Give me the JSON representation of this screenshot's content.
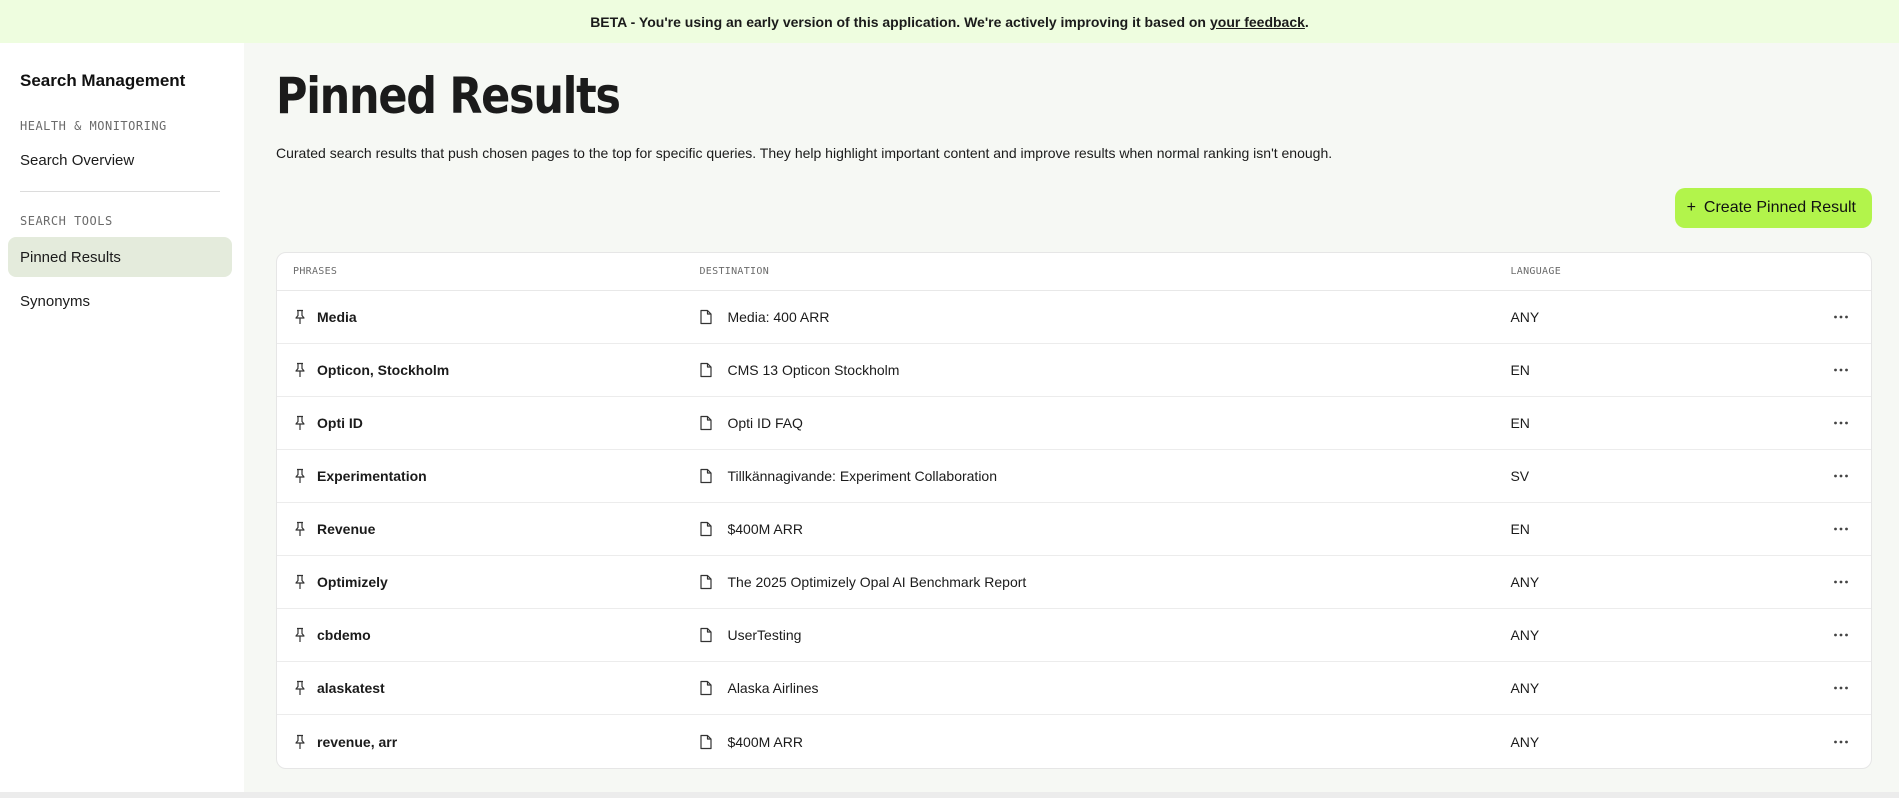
{
  "banner": {
    "text": "BETA - You're using an early version of this application. We're actively improving it based on",
    "link": "your feedback",
    "suffix": "."
  },
  "sidebar": {
    "title": "Search Management",
    "section_health": "HEALTH & MONITORING",
    "item_overview": "Search Overview",
    "section_tools": "SEARCH TOOLS",
    "item_pinned": "Pinned Results",
    "item_synonyms": "Synonyms"
  },
  "main": {
    "title": "Pinned Results",
    "description": "Curated search results that push chosen pages to the top for specific queries. They help highlight important content and improve results when normal ranking isn't enough.",
    "create_button": "Create Pinned Result"
  },
  "table": {
    "headers": {
      "phrases": "PHRASES",
      "destination": "DESTINATION",
      "language": "LANGUAGE"
    },
    "rows": [
      {
        "phrase": "Media",
        "destination": "Media: 400 ARR",
        "language": "ANY"
      },
      {
        "phrase": "Opticon, Stockholm",
        "destination": "CMS 13 Opticon Stockholm",
        "language": "EN"
      },
      {
        "phrase": "Opti ID",
        "destination": "Opti ID FAQ",
        "language": "EN"
      },
      {
        "phrase": "Experimentation",
        "destination": "Tillkännagivande: Experiment Collaboration",
        "language": "SV"
      },
      {
        "phrase": "Revenue",
        "destination": "$400M ARR",
        "language": "EN"
      },
      {
        "phrase": "Optimizely",
        "destination": "The 2025 Optimizely Opal AI Benchmark Report",
        "language": "ANY"
      },
      {
        "phrase": "cbdemo",
        "destination": "UserTesting",
        "language": "ANY"
      },
      {
        "phrase": "alaskatest",
        "destination": "Alaska Airlines",
        "language": "ANY"
      },
      {
        "phrase": "revenue, arr",
        "destination": "$400M ARR",
        "language": "ANY"
      }
    ]
  },
  "icons": {
    "pin": "pin-icon",
    "document": "document-icon",
    "more": "more-horizontal-icon",
    "plus": "plus-icon"
  },
  "colors": {
    "banner_bg": "#eefddf",
    "accent": "#b2f44b",
    "active_nav": "#e4ebdc",
    "main_bg": "#f6f8f4"
  }
}
